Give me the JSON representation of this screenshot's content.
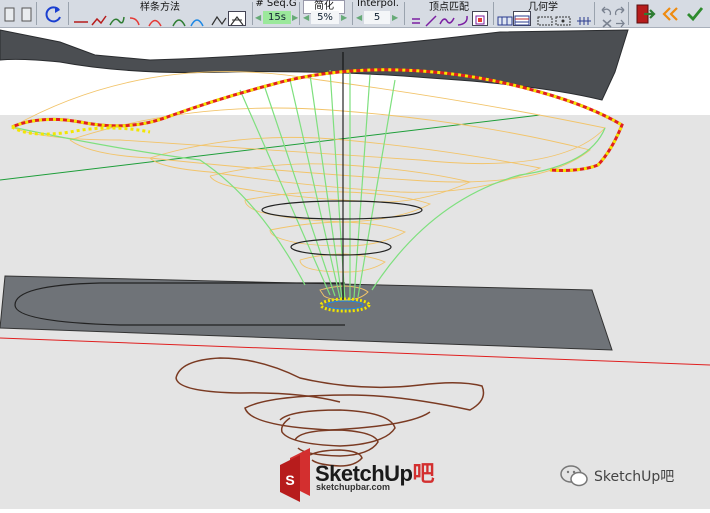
{
  "toolbar": {
    "spline_method_label": "样条方法",
    "seq_label": "# Seq.G",
    "seq_value": "15s",
    "simplify_label": "简化",
    "simplify_value": "5%",
    "interpol_label": "Interpol.",
    "interpol_value": "5",
    "vertex_match_label": "顶点匹配",
    "geometry_label": "几何学"
  },
  "watermark": {
    "brand": "SketchUp",
    "suffix": "吧",
    "url": "sketchupbar.com",
    "wechat": "SketchUp吧"
  },
  "colors": {
    "accent_red": "#e02020",
    "accent_yellow": "#f2e600",
    "curve_green": "#7ee07e",
    "curve_orange": "#f2c46a",
    "plane_gray": "#6f7378",
    "brown_curve": "#7a3a22"
  }
}
